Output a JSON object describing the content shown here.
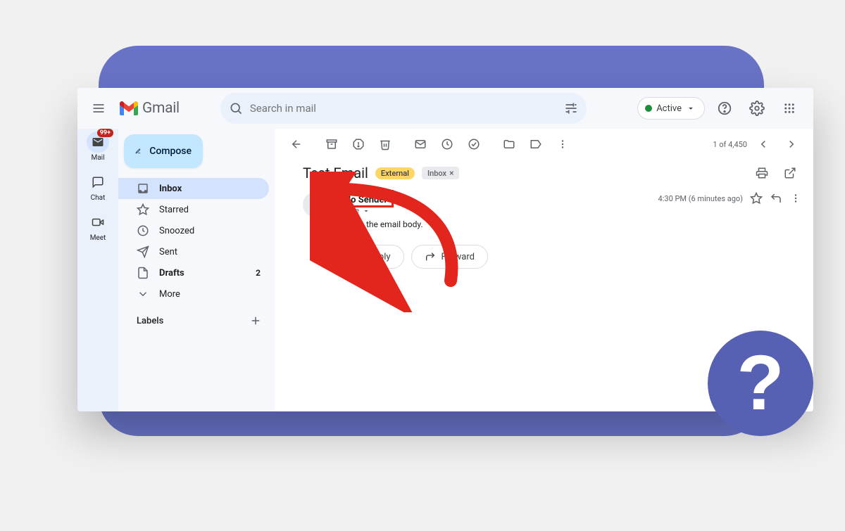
{
  "app": {
    "name": "Gmail"
  },
  "search": {
    "placeholder": "Search in mail"
  },
  "status": {
    "label": "Active"
  },
  "rail": {
    "mail": {
      "label": "Mail",
      "badge": "99+"
    },
    "chat": {
      "label": "Chat"
    },
    "meet": {
      "label": "Meet"
    }
  },
  "compose": {
    "label": "Compose"
  },
  "nav": {
    "inbox": {
      "label": "Inbox"
    },
    "starred": {
      "label": "Starred"
    },
    "snoozed": {
      "label": "Snoozed"
    },
    "sent": {
      "label": "Sent"
    },
    "drafts": {
      "label": "Drafts",
      "count": "2"
    },
    "more": {
      "label": "More"
    }
  },
  "labels": {
    "heading": "Labels"
  },
  "toolbar": {
    "pagination": "1 of 4,450"
  },
  "email": {
    "subject": "Test Email",
    "external_chip": "External",
    "inbox_chip": "Inbox",
    "sender": "No Sender",
    "to": "to me",
    "timestamp": "4:30 PM (6 minutes ago)",
    "body": "This is the email body.",
    "reply": "Reply",
    "forward": "Forward"
  },
  "help_bubble": "?",
  "colors": {
    "accent": "#6873c6",
    "highlight": "#e2261d"
  }
}
